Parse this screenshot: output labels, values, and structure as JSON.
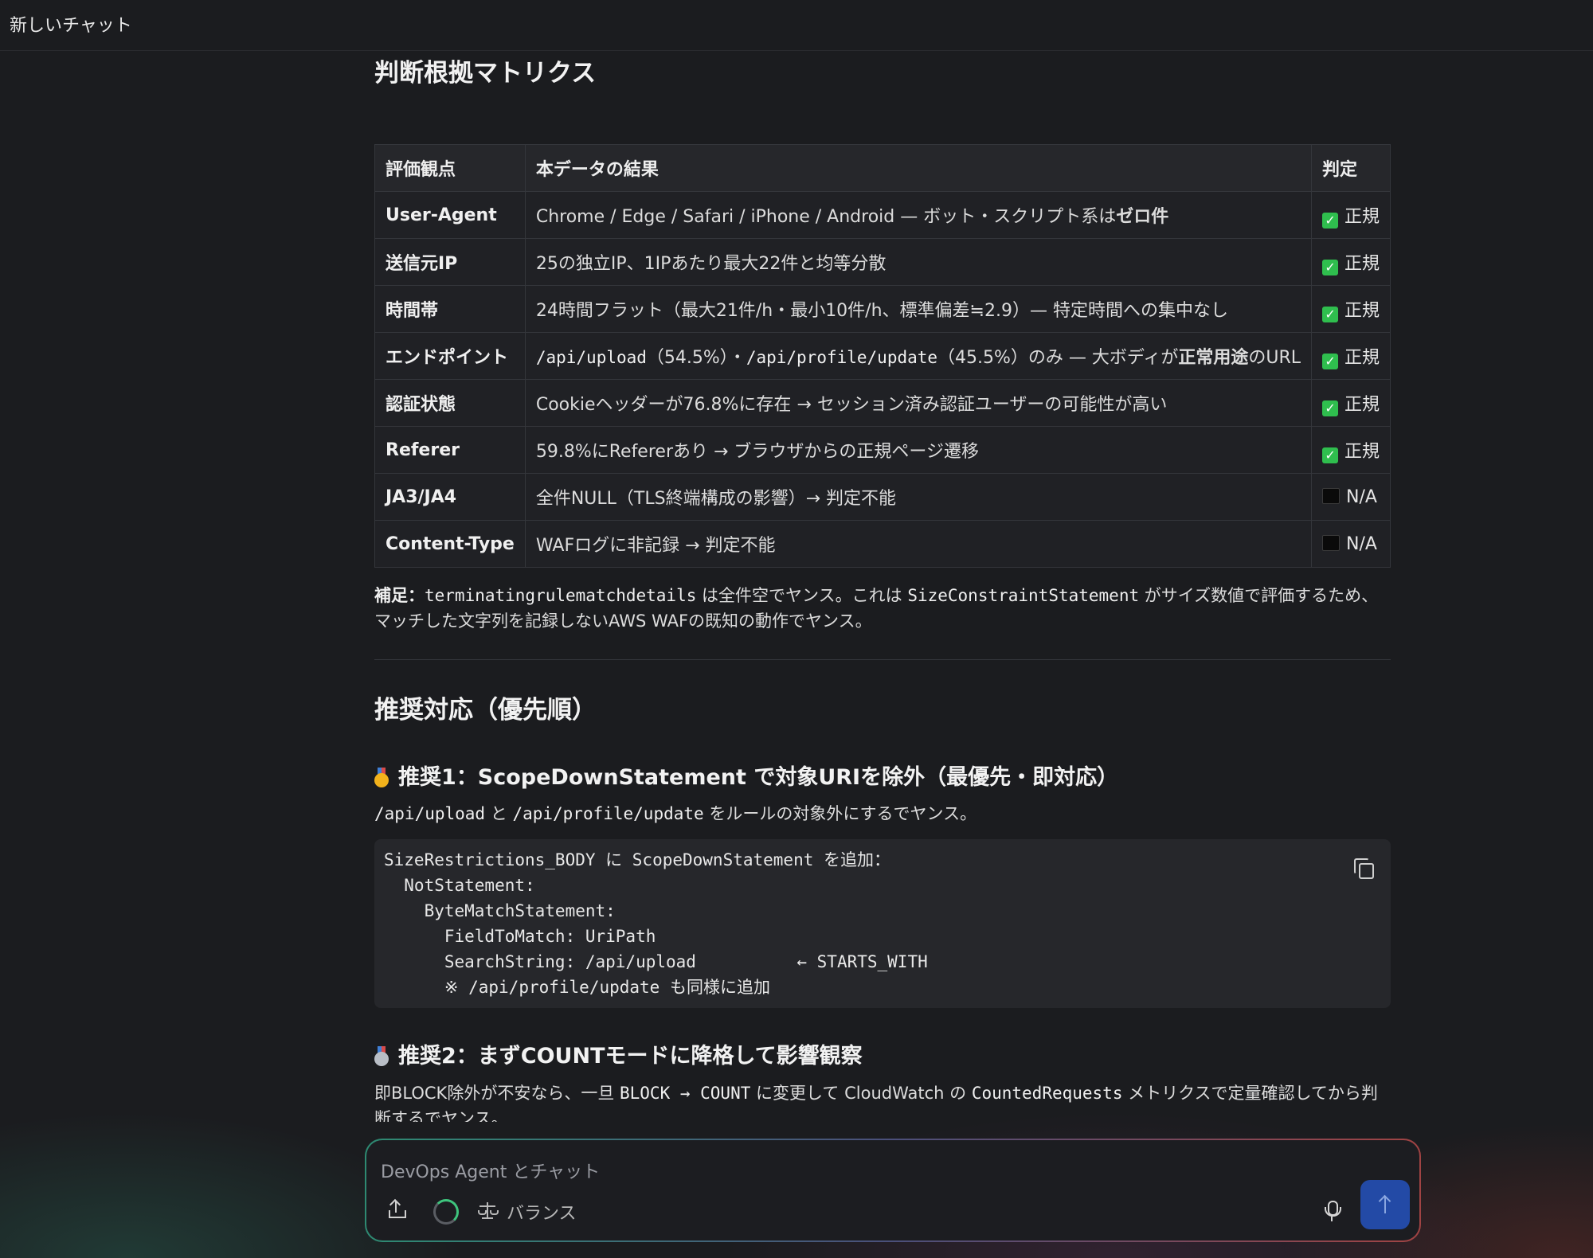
{
  "topbar": {
    "title": "新しいチャット"
  },
  "section1": {
    "title": "判断根拠マトリクス"
  },
  "matrix": {
    "headers": [
      "評価観点",
      "本データの結果",
      "判定"
    ],
    "rows": [
      {
        "aspect": "User-Agent",
        "result_pre": "Chrome / Edge / Safari / iPhone / Android — ボット・スクリプト系は",
        "result_bold": "ゼロ件",
        "verdict": "正規",
        "verdict_icon": "check-icon"
      },
      {
        "aspect": "送信元IP",
        "result_pre": "25の独立IP、1IPあたり最大22件と均等分散",
        "verdict": "正規",
        "verdict_icon": "check-icon"
      },
      {
        "aspect": "時間帯",
        "result_pre": "24時間フラット（最大21件/h・最小10件/h、標準偏差≒2.9）— 特定時間への集中なし",
        "verdict": "正規",
        "verdict_icon": "check-icon"
      },
      {
        "aspect": "エンドポイント",
        "code1": "/api/upload",
        "mid1": "（54.5%）・",
        "code2": "/api/profile/update",
        "mid2": "（45.5%）のみ — 大ボディが",
        "bold": "正常用途",
        "tail": "のURL",
        "verdict": "正規",
        "verdict_icon": "check-icon"
      },
      {
        "aspect": "認証状態",
        "result_pre": "Cookieヘッダーが76.8%に存在 → セッション済み認証ユーザーの可能性が高い",
        "verdict": "正規",
        "verdict_icon": "check-icon"
      },
      {
        "aspect": "Referer",
        "result_pre": "59.8%にRefererあり → ブラウザからの正規ページ遷移",
        "verdict": "正規",
        "verdict_icon": "check-icon"
      },
      {
        "aspect": "JA3/JA4",
        "result_pre": "全件NULL（TLS終端構成の影響）→ 判定不能",
        "verdict": "N/A",
        "verdict_icon": "black-square-icon"
      },
      {
        "aspect": "Content-Type",
        "result_pre": "WAFログに非記録 → 判定不能",
        "verdict": "N/A",
        "verdict_icon": "black-square-icon"
      }
    ]
  },
  "note": {
    "label": "補足：",
    "code1": "terminatingrulematchdetails",
    "text1": " は全件空でヤンス。これは ",
    "code2": "SizeConstraintStatement",
    "text2": " がサイズ数値で評価するため、マッチした文字列を記録しないAWS WAFの既知の動作でヤンス。"
  },
  "section2": {
    "title": "推奨対応（優先順）"
  },
  "rec1": {
    "title": "推奨1：ScopeDownStatement で対象URIを除外（最優先・即対応）",
    "medal": "gold-medal-icon",
    "code1": "/api/upload",
    "text1": " と ",
    "code2": "/api/profile/update",
    "text2": " をルールの対象外にするでヤンス。",
    "codeblock": "SizeRestrictions_BODY に ScopeDownStatement を追加：\n  NotStatement:\n    ByteMatchStatement:\n      FieldToMatch: UriPath\n      SearchString: /api/upload          ← STARTS_WITH\n      ※ /api/profile/update も同様に追加"
  },
  "rec2": {
    "title": "推奨2：まずCOUNTモードに降格して影響観察",
    "medal": "silver-medal-icon",
    "text1": "即BLOCK除外が不安なら、一旦 ",
    "code1": "BLOCK → COUNT",
    "text2": " に変更して CloudWatch の ",
    "code2": "CountedRequests",
    "text3": " メトリクスで定量確認してから判断するでヤンス。"
  },
  "composer": {
    "placeholder": "DevOps Agent とチャット",
    "mode_label": "バランス"
  },
  "colors": {
    "accent": "#234aa6",
    "check": "#2fbe4e",
    "background": "#1b1c1f"
  }
}
